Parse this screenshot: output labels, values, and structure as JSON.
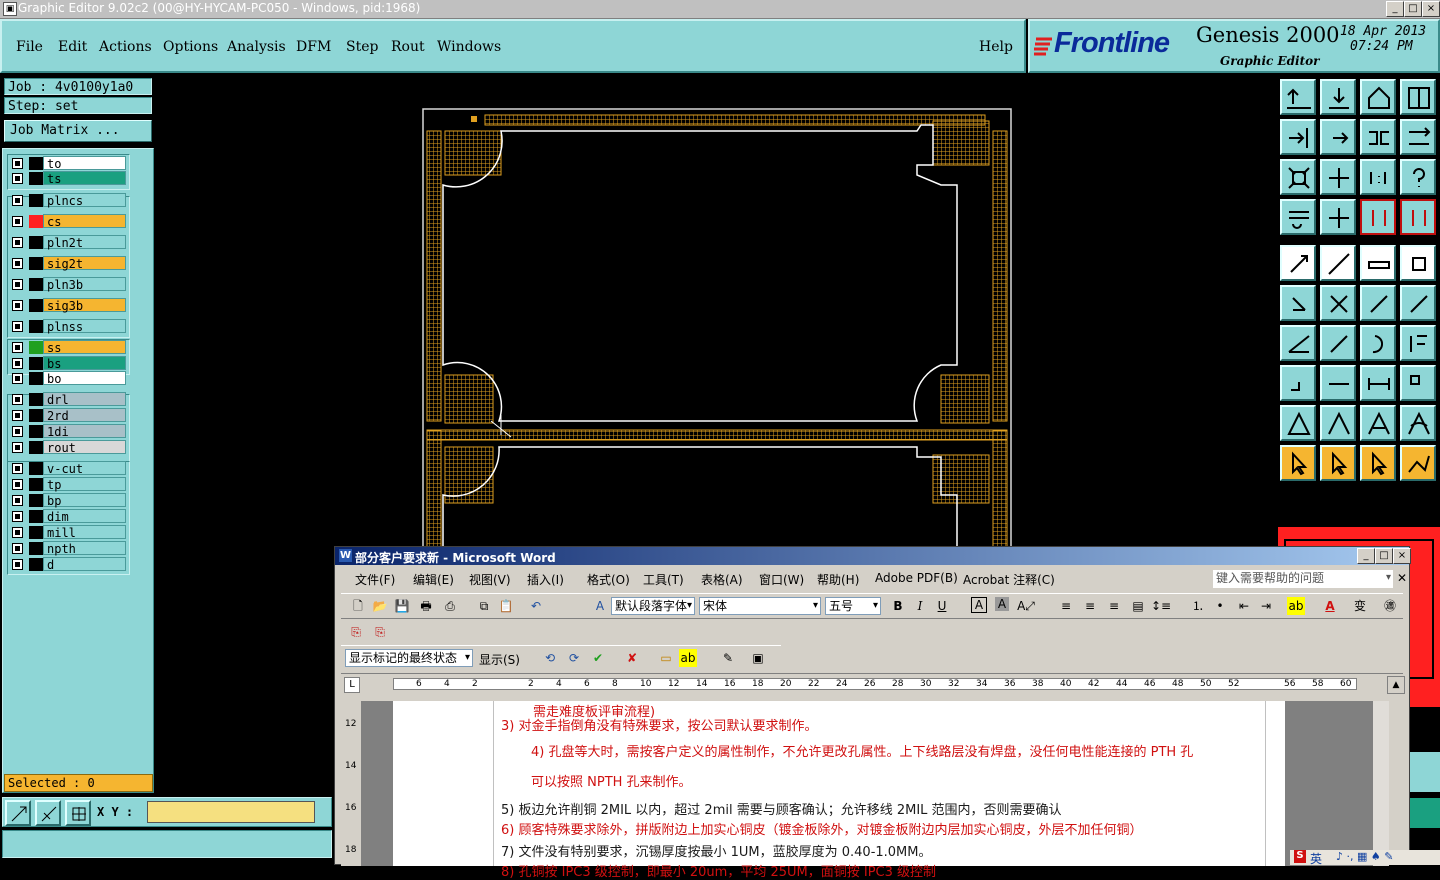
{
  "genesis_window": {
    "title": "Graphic Editor 9.02c2 (00@HY-HYCAM-PC050 - Windows, pid:1968)",
    "menu": [
      "File",
      "Edit",
      "Actions",
      "Options",
      "Analysis",
      "DFM",
      "Step",
      "Rout",
      "Windows"
    ],
    "help": "Help",
    "logo": {
      "brand": "Frontline",
      "product": "Genesis 2000",
      "subtitle": "Graphic Editor",
      "date": "18 Apr 2013",
      "time": "07:24 PM"
    }
  },
  "job_info": {
    "job": "Job : 4v0100y1a0",
    "step": "Step: set",
    "job_matrix": "Job Matrix ..."
  },
  "layers": [
    {
      "name": "to",
      "color": "#ffffff",
      "swatch": "#000000"
    },
    {
      "name": "ts",
      "color": "#1aa080",
      "swatch": "#000000"
    },
    {
      "name": "plncs",
      "color": "#8ed6d6",
      "swatch": "#000000"
    },
    {
      "name": "cs",
      "color": "#f5b530",
      "swatch": "#ff2020"
    },
    {
      "name": "pln2t",
      "color": "#8ed6d6",
      "swatch": "#000000"
    },
    {
      "name": "sig2t",
      "color": "#f5b530",
      "swatch": "#000000"
    },
    {
      "name": "pln3b",
      "color": "#8ed6d6",
      "swatch": "#000000"
    },
    {
      "name": "sig3b",
      "color": "#f5b530",
      "swatch": "#000000"
    },
    {
      "name": "plnss",
      "color": "#8ed6d6",
      "swatch": "#000000"
    },
    {
      "name": "ss",
      "color": "#f5b530",
      "swatch": "#20a020"
    },
    {
      "name": "bs",
      "color": "#1aa080",
      "swatch": "#000000"
    },
    {
      "name": "bo",
      "color": "#ffffff",
      "swatch": "#000000"
    },
    {
      "name": "drl",
      "color": "#a8c0c8",
      "swatch": "#000000"
    },
    {
      "name": "2rd",
      "color": "#a8c0c8",
      "swatch": "#000000"
    },
    {
      "name": "1di",
      "color": "#a8c0c8",
      "swatch": "#000000"
    },
    {
      "name": "rout",
      "color": "#d8d8d8",
      "swatch": "#000000"
    },
    {
      "name": "v-cut",
      "color": "#8ed6d6",
      "swatch": "#000000"
    },
    {
      "name": "tp",
      "color": "#8ed6d6",
      "swatch": "#000000"
    },
    {
      "name": "bp",
      "color": "#8ed6d6",
      "swatch": "#000000"
    },
    {
      "name": "dim",
      "color": "#8ed6d6",
      "swatch": "#000000"
    },
    {
      "name": "mill",
      "color": "#8ed6d6",
      "swatch": "#000000"
    },
    {
      "name": "npth",
      "color": "#8ed6d6",
      "swatch": "#000000"
    },
    {
      "name": "d",
      "color": "#8ed6d6",
      "swatch": "#000000"
    }
  ],
  "selected": "Selected : 0",
  "coord_label": "X Y :",
  "coord_value": "",
  "board_color": "#e0a020",
  "word_window": {
    "title": "部分客户要求新 - Microsoft Word",
    "menu": [
      "文件(F)",
      "编辑(E)",
      "视图(V)",
      "插入(I)",
      "格式(O)",
      "工具(T)",
      "表格(A)",
      "窗口(W)",
      "帮助(H)",
      "Adobe PDF(B)",
      "Acrobat 注释(C)"
    ],
    "help_placeholder": "键入需要帮助的问题",
    "style_combo": "默认段落字体",
    "font_combo": "宋体",
    "size_combo": "五号",
    "markup_combo": "显示标记的最终状态",
    "show_menu": "显示(S)",
    "ruler_numbers": [
      "6",
      "4",
      "2",
      "",
      "2",
      "4",
      "6",
      "8",
      "10",
      "12",
      "14",
      "16",
      "18",
      "20",
      "22",
      "24",
      "26",
      "28",
      "30",
      "32",
      "34",
      "36",
      "38",
      "40",
      "42",
      "44",
      "46",
      "48",
      "50",
      "52",
      "",
      "56",
      "58",
      "60"
    ],
    "vruler_numbers": [
      "12",
      "14",
      "16",
      "18"
    ],
    "doc_lines": [
      "需走难度板评审流程)",
      "3)   对金手指倒角没有特殊要求，按公司默认要求制作。",
      "4)   孔盘等大时，需按客户定义的属性制作，不允许更改孔属性。上下线路层没有焊盘，没任何电性能连接的 PTH 孔",
      "可以按照 NPTH 孔来制作。",
      "5)   板边允许削铜 2MIL 以内，超过 2mil 需要与顾客确认；允许移线 2MIL 范围内，否则需要确认",
      "6)   顾客特殊要求除外，拼版附边上加实心铜皮（镀金板除外，对镀金板附边内层加实心铜皮，外层不加任何铜）",
      "7)   文件没有特别要求，沉锡厚度按最小 1UM，蓝胶厚度为 0.40-1.0MM。",
      "8)   孔铜按 IPC3 级控制，即最小 20um，平均 25UM，面铜按 IPC3 级控制"
    ]
  },
  "taskbar_ime": "英"
}
